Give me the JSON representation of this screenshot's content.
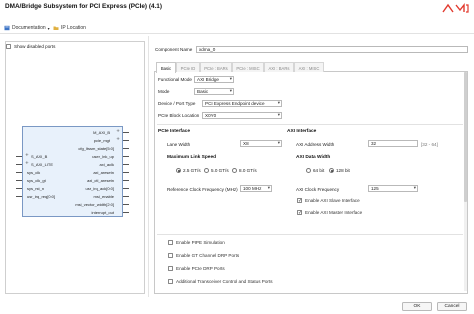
{
  "window": {
    "title": "DMA/Bridge Subsystem for PCI Express (PCIe) (4.1)"
  },
  "toolbar": {
    "documentation": "Documentation",
    "ip_location": "IP Location"
  },
  "symbol": {
    "show_disabled_ports": "Show disabled ports",
    "right_signals": [
      "M_AXI_B",
      "pcie_mgt",
      "cfg_ltssm_state[5:0]",
      "user_lnk_up",
      "axi_aclk",
      "axi_aresetn",
      "axi_ctl_aresetn",
      "usr_irq_ack[0:0]",
      "msi_enable",
      "msi_vector_width[2:0]",
      "interrupt_out"
    ],
    "left_signals": [
      "S_AXI_B",
      "S_AXI_LITE",
      "sys_clk",
      "sys_clk_gt",
      "sys_rst_n",
      "usr_irq_req[0:0]"
    ]
  },
  "config": {
    "component_name_label": "Component Name",
    "component_name_value": "xdma_0",
    "tabs": [
      "Basic",
      "PCIe ID",
      "PCIe : BARs",
      "PCIe : MISC",
      "AXI : BARs",
      "AXI : MISC"
    ],
    "active_tab": "Basic",
    "functional_mode": {
      "label": "Functional Mode",
      "value": "AXI Bridge"
    },
    "mode": {
      "label": "Mode",
      "value": "Basic"
    },
    "device_port_type": {
      "label": "Device / Port Type",
      "value": "PCI Express Endpoint device"
    },
    "pcie_block_location": {
      "label": "PCIe Block Location",
      "value": "X0Y0"
    },
    "pcie_interface": {
      "title": "PCIe Interface",
      "lane_width_label": "Lane Width",
      "lane_width_value": "X8",
      "max_link_speed_title": "Maximum Link Speed",
      "speeds": [
        "2.5 GT/s",
        "5.0 GT/s",
        "8.0 GT/s"
      ],
      "speed_selected": 0,
      "ref_clk_label": "Reference Clock Frequency (MHz)",
      "ref_clk_value": "100 MHz"
    },
    "axi_interface": {
      "title": "AXI Interface",
      "addr_width_label": "AXI Address Width",
      "addr_width_value": "32",
      "addr_width_range": "[32 - 64]",
      "data_width_title": "AXI Data Width",
      "data_widths": [
        "64 bit",
        "128 bit"
      ],
      "data_width_selected": 1,
      "clk_freq_label": "AXI Clock Frequency",
      "clk_freq_value": "125",
      "slave_label": "Enable AXI Slave Interface",
      "slave_checked": true,
      "master_label": "Enable AXI Master Interface",
      "master_checked": true
    },
    "options": [
      {
        "label": "Enable PIPE Simulation",
        "checked": false
      },
      {
        "label": "Enable GT Channel DRP Ports",
        "checked": false
      },
      {
        "label": "Enable PCIe DRP Ports",
        "checked": false
      },
      {
        "label": "Additional Transceiver Control and Status Ports",
        "checked": false
      }
    ]
  },
  "footer": {
    "ok": "OK",
    "cancel": "Cancel"
  },
  "colors": {
    "block_fill": "#e8f1fb",
    "block_border": "#7a98c4",
    "logo_red": "#e23a2e"
  }
}
